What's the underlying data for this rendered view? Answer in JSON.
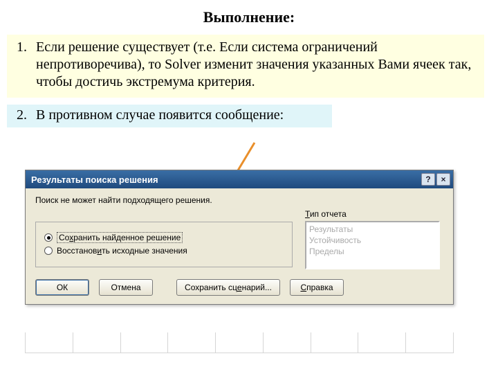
{
  "title": "Выполнение:",
  "item1": {
    "num": "1.",
    "text": "Если решение существует (т.е. Если система ограничений непротиворечива), то Solver изменит значения указанных Вами ячеек так, чтобы достичь экстремума критерия."
  },
  "item2": {
    "num": "2.",
    "text": "В противном случае появится сообщение:"
  },
  "dialog": {
    "title": "Результаты поиска решения",
    "help_btn": "?",
    "close_btn": "×",
    "message": "Поиск не может найти подходящего решения.",
    "radio_keep_pre": "Со",
    "radio_keep_u": "х",
    "radio_keep_post": "ранить найденное решение",
    "radio_restore_pre": "Восстанов",
    "radio_restore_u": "и",
    "radio_restore_post": "ть исходные значения",
    "report_label_u": "Т",
    "report_label_post": "ип отчета",
    "reports": {
      "r1": "Результаты",
      "r2": "Устойчивость",
      "r3": "Пределы"
    },
    "buttons": {
      "ok": "ОК",
      "cancel": "Отмена",
      "save_pre": "Сохранить сц",
      "save_u": "е",
      "save_post": "нарий...",
      "help_pre": "",
      "help_u": "С",
      "help_post": "правка"
    }
  }
}
